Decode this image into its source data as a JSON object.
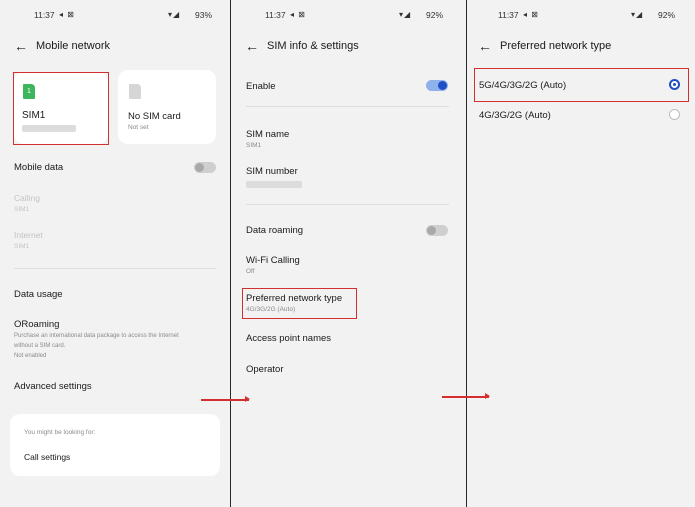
{
  "panel1": {
    "status": {
      "time": "11:37",
      "icons": "◂ ⊠",
      "signal": "▾◢",
      "battery": "93%"
    },
    "title": "Mobile network",
    "sim1": {
      "badge": "1",
      "label": "SIM1"
    },
    "sim2": {
      "label": "No SIM card",
      "sub": "Not set"
    },
    "mobile_data": "Mobile data",
    "calling": {
      "label": "Calling",
      "sub": "SIM1"
    },
    "internet": {
      "label": "Internet",
      "sub": "SIM1"
    },
    "data_usage": "Data usage",
    "oroaming": {
      "label": "ORoaming",
      "desc": [
        "Purchase an international data package to access the Internet",
        "without a SIM card."
      ],
      "status": "Not enabled"
    },
    "advanced": "Advanced settings",
    "looking": {
      "heading": "You might be looking for:",
      "item": "Call settings"
    }
  },
  "panel2": {
    "status": {
      "time": "11:37",
      "icons": "◂ ⊠",
      "signal": "▾◢",
      "battery": "92%"
    },
    "title": "SIM info & settings",
    "enable": {
      "label": "Enable",
      "on": true
    },
    "sim_name": {
      "label": "SIM name",
      "value": "SIM1"
    },
    "sim_number": {
      "label": "SIM number"
    },
    "data_roaming": {
      "label": "Data roaming",
      "on": false
    },
    "wifi_calling": {
      "label": "Wi-Fi Calling",
      "value": "Off"
    },
    "preferred": {
      "label": "Preferred network type",
      "value": "4G/3G/2G (Auto)"
    },
    "apn": "Access point names",
    "operator": "Operator"
  },
  "panel3": {
    "status": {
      "time": "11:37",
      "icons": "◂ ⊠",
      "signal": "▾◢",
      "battery": "92%"
    },
    "title": "Preferred network type",
    "options": [
      {
        "label": "5G/4G/3G/2G (Auto)",
        "selected": true
      },
      {
        "label": "4G/3G/2G (Auto)",
        "selected": false
      }
    ]
  },
  "colors": {
    "accent": "#1f4fc4",
    "highlight": "#d32f2f",
    "sim_green": "#3db55c"
  }
}
